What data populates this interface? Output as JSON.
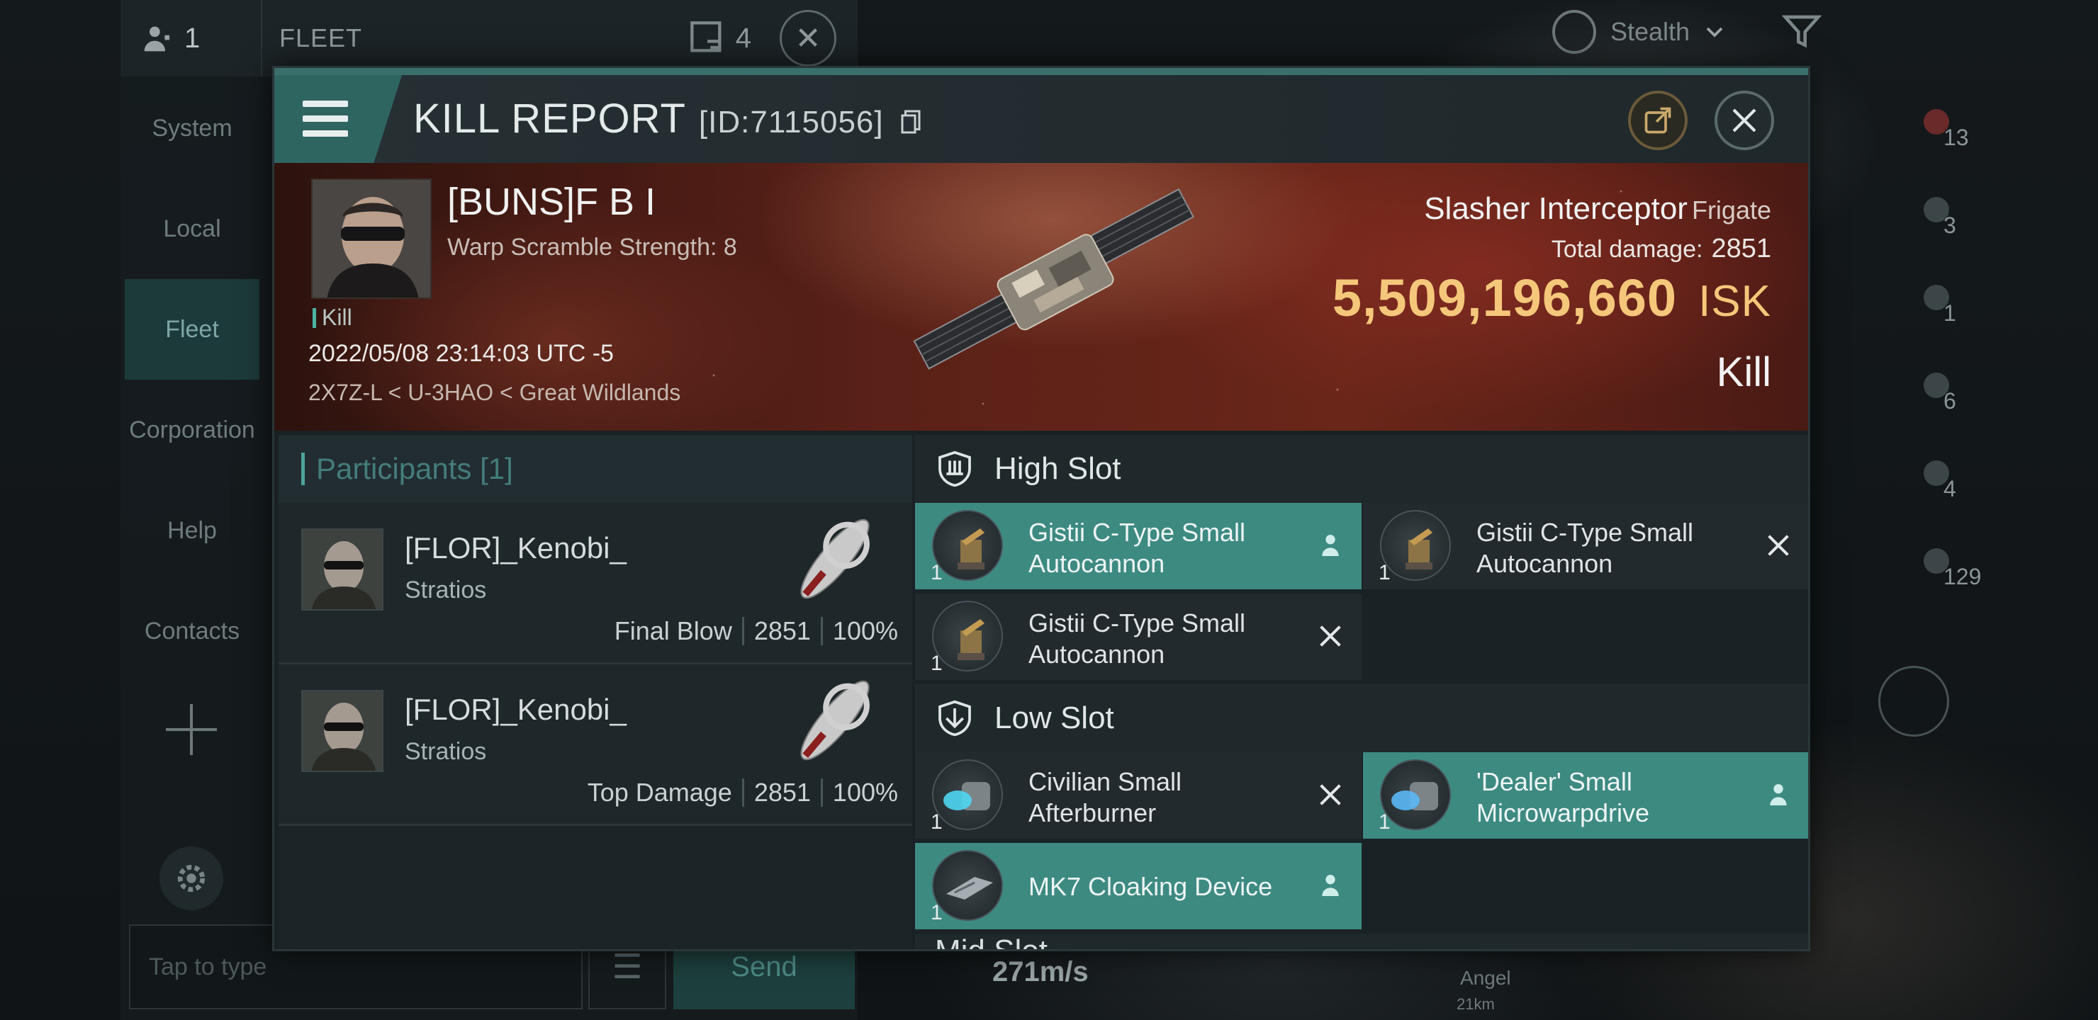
{
  "background_ui": {
    "members_count": "1",
    "panel_title": "FLEET",
    "fleet_count": "4",
    "channels": [
      "System",
      "Local",
      "Fleet",
      "Corporation",
      "Help",
      "Contacts"
    ],
    "active_channel": "Fleet",
    "chat_placeholder": "Tap to type",
    "send_label": "Send",
    "mode_label": "Stealth",
    "overview_counts": [
      "13",
      "3",
      "1",
      "6",
      "4",
      "129"
    ],
    "speed": "271m/s",
    "target_name": "Angel",
    "target_distance": "21km"
  },
  "kill_report": {
    "title": "KILL REPORT",
    "id": "[ID:7115056]",
    "victim": {
      "name": "[BUNS]F B I",
      "subtitle": "Warp Scramble Strength: 8",
      "tag": "Kill",
      "time": "2022/05/08 23:14:03 UTC -5",
      "location": "2X7Z-L < U-3HAO < Great Wildlands"
    },
    "ship": {
      "name": "Slasher Interceptor",
      "class": "Frigate",
      "total_damage_label": "Total damage:",
      "total_damage": "2851",
      "isk_value": "5,509,196,660",
      "isk_unit": "ISK",
      "result": "Kill"
    },
    "participants": {
      "header": "Participants [1]",
      "rows": [
        {
          "name": "[FLOR]_Kenobi_",
          "ship": "Stratios",
          "role": "Final Blow",
          "damage": "2851",
          "percent": "100%"
        },
        {
          "name": "[FLOR]_Kenobi_",
          "ship": "Stratios",
          "role": "Top Damage",
          "damage": "2851",
          "percent": "100%"
        }
      ]
    },
    "high_slot": {
      "label": "High Slot",
      "modules": [
        {
          "name": "Gistii C-Type Small Autocannon",
          "qty": "1",
          "status": "fitted"
        },
        {
          "name": "Gistii C-Type Small Autocannon",
          "qty": "1",
          "status": "destroyed"
        },
        {
          "name": "Gistii C-Type Small Autocannon",
          "qty": "1",
          "status": "destroyed"
        }
      ]
    },
    "low_slot": {
      "label": "Low Slot",
      "modules": [
        {
          "name": "Civilian Small Afterburner",
          "qty": "1",
          "status": "destroyed"
        },
        {
          "name": "'Dealer' Small Microwarpdrive",
          "qty": "1",
          "status": "fitted"
        },
        {
          "name": "MK7 Cloaking Device",
          "qty": "1",
          "status": "fitted"
        }
      ]
    },
    "mid_slot_peek": "Mid Slot"
  },
  "colors": {
    "accent_teal": "#3d8a81",
    "isk_gold": "#f5c77a",
    "banner_red": "#5a2118"
  }
}
